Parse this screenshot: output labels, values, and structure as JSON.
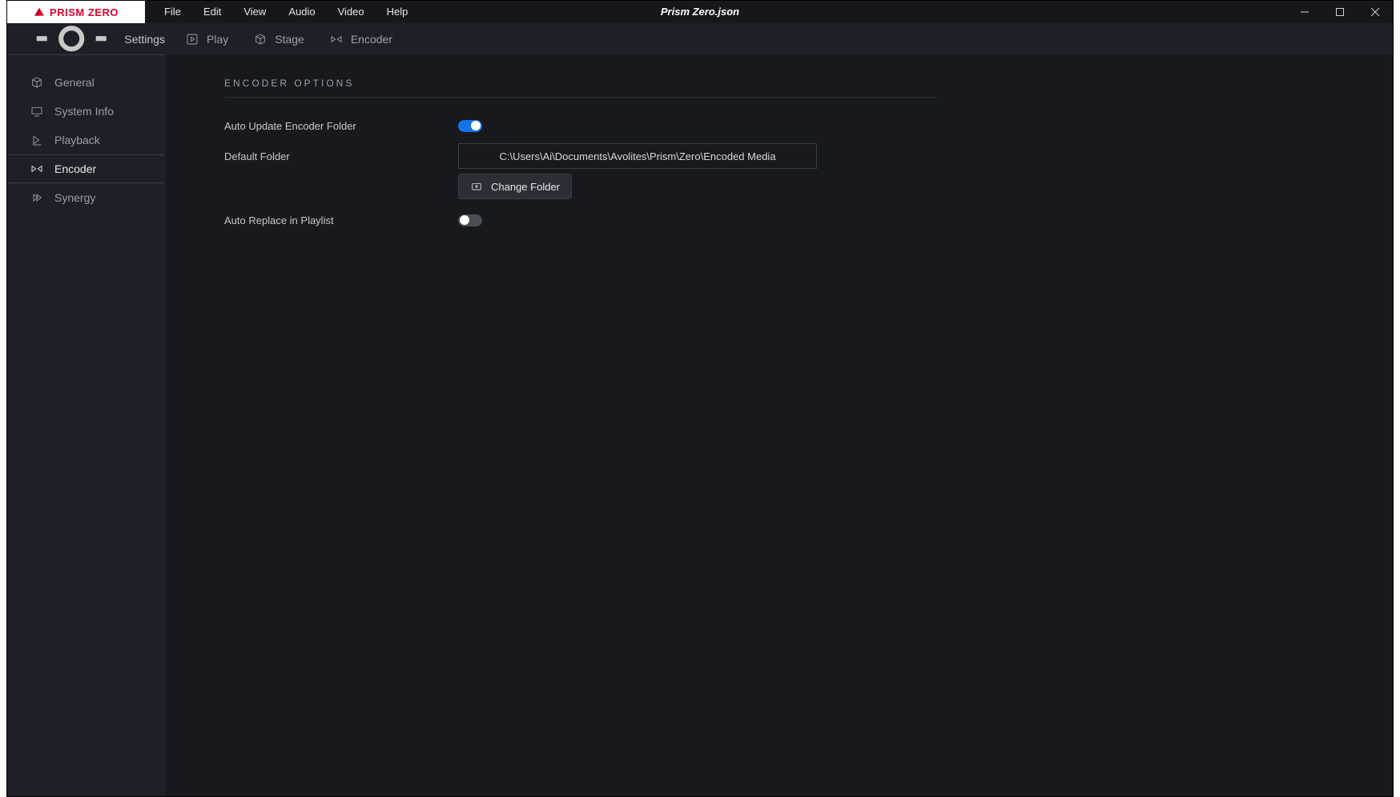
{
  "app": {
    "logo_text": "PRISM ZERO",
    "window_title": "Prism Zero.json"
  },
  "menu": {
    "items": [
      "File",
      "Edit",
      "View",
      "Audio",
      "Video",
      "Help"
    ]
  },
  "subbar": {
    "settings_label": "Settings",
    "tabs": [
      {
        "label": "Play"
      },
      {
        "label": "Stage"
      },
      {
        "label": "Encoder"
      }
    ]
  },
  "sidebar": {
    "items": [
      {
        "label": "General"
      },
      {
        "label": "System Info"
      },
      {
        "label": "Playback"
      },
      {
        "label": "Encoder"
      },
      {
        "label": "Synergy"
      }
    ],
    "active_index": 3
  },
  "encoder": {
    "section_title": "ENCODER OPTIONS",
    "auto_update_label": "Auto Update Encoder Folder",
    "auto_update_on": true,
    "default_folder_label": "Default Folder",
    "default_folder_value": "C:\\Users\\Ai\\Documents\\Avolites\\Prism\\Zero\\Encoded Media",
    "change_folder_label": "Change Folder",
    "auto_replace_label": "Auto Replace in Playlist",
    "auto_replace_on": false
  }
}
